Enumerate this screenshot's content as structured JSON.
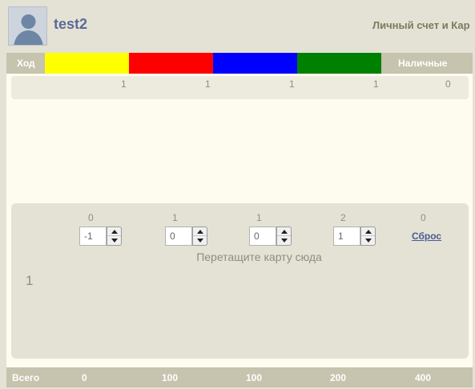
{
  "header": {
    "username": "test2",
    "account_link": "Личный счет и Кар"
  },
  "topbar": {
    "turn_label": "Ход",
    "cash_label": "Наличные",
    "colors": [
      "#ffff00",
      "#ff0000",
      "#0000ff",
      "#008000"
    ]
  },
  "counts_row": [
    "1",
    "1",
    "1",
    "1",
    "0"
  ],
  "dropzone": {
    "numbers": [
      "0",
      "1",
      "1",
      "2",
      "0"
    ],
    "spinner_values": [
      "-1",
      "0",
      "0",
      "1"
    ],
    "reset_label": "Сброс",
    "hint": "Перетащите карту сюда",
    "turn_number": "1"
  },
  "totals": {
    "label": "Всего",
    "values": [
      "0",
      "100",
      "100",
      "200",
      "400"
    ]
  }
}
